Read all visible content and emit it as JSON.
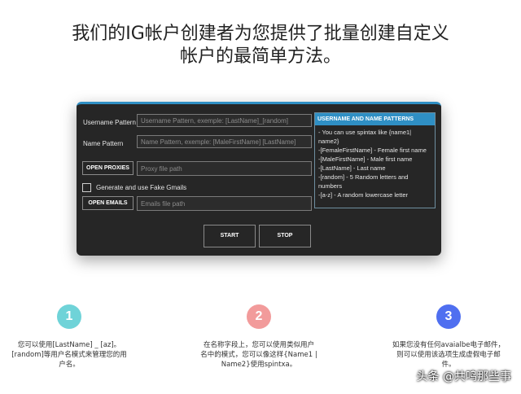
{
  "headline": {
    "line1": "我们的IG帐户创建者为您提供了批量创建自定义",
    "line2": "帐户的最简单方法。"
  },
  "app": {
    "accent_color": "#2f8fc4",
    "username_pattern_label": "Username Pattern",
    "username_pattern_placeholder": "Username Pattern, exemple: [LastName]_[random]",
    "name_pattern_label": "Name Pattern",
    "name_pattern_placeholder": "Name Pattern, exemple: [MaleFirstName] [LastName]",
    "open_proxies_label": "OPEN PROXIES",
    "proxy_placeholder": "Proxy file path",
    "fake_gmails_label": "Generate and use Fake Gmails",
    "open_emails_label": "OPEN EMAILS",
    "emails_placeholder": "Emails file path",
    "start_label": "START",
    "stop_label": "STOP",
    "patterns": {
      "title": "USERNAME AND NAME PATTERNS",
      "lines": [
        "- You can use spintax like {name1|",
        "name2}",
        "-[FemaleFirstName] - Female first name",
        "-[MaleFirstName] - Male first name",
        "-[LastName] - Last name",
        "-[random] - 5 Random letters and",
        "numbers",
        "-[a-z] - A random lowercase letter"
      ]
    }
  },
  "steps": [
    {
      "number": "1",
      "color": "#6fd3d8",
      "lines": [
        "您可以使用[LastName] _ [az]。",
        "[random]等用户名模式来管理您的用",
        "户名。"
      ]
    },
    {
      "number": "2",
      "color": "#f29b9b",
      "lines": [
        "在名称字段上，您可以使用类似用户",
        "名中的模式，您可以像这样{Name1 |",
        "Name2}使用spintxa。"
      ]
    },
    {
      "number": "3",
      "color": "#4f6ff0",
      "lines": [
        "如果您没有任何avaialbe电子邮件，",
        "则可以使用该选项生成虚假电子邮",
        "件。"
      ]
    }
  ],
  "watermark": "头条 @共鸣那些事"
}
